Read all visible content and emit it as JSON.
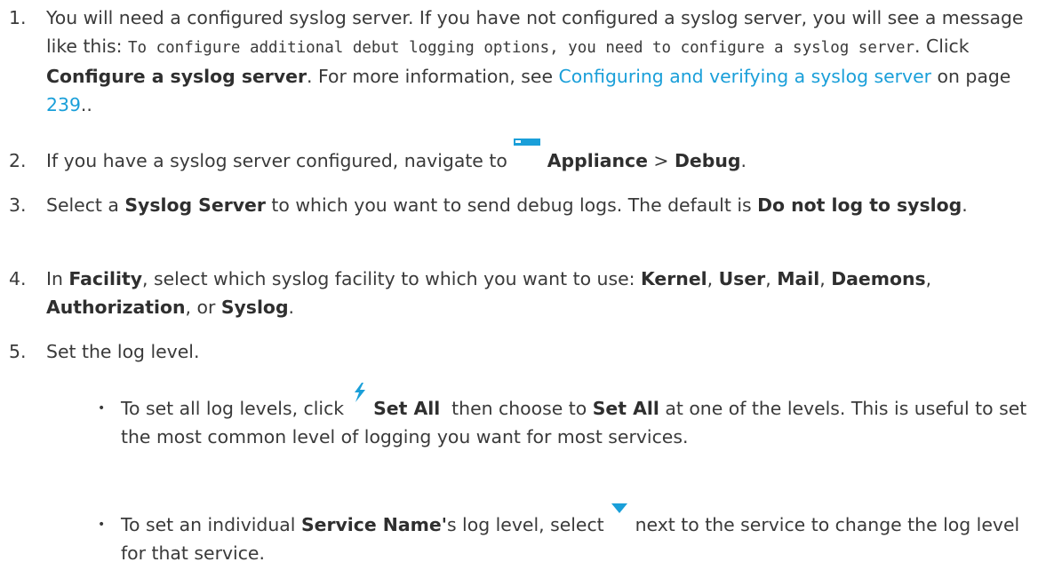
{
  "steps": [
    {
      "num": "1.",
      "t1": "You will need a configured syslog server. If you have not configured a syslog server, you will see a message like this: ",
      "code": "To configure additional debut logging options, you need to configure a syslog server",
      "t2": ". Click ",
      "b1": "Configure a syslog server",
      "t3": ". For more information, see ",
      "link": "Configuring and verifying a syslog server",
      "t4": " on page ",
      "page": "239",
      "t5": ".."
    },
    {
      "num": "2.",
      "t1": "If you have a syslog server configured, navigate to ",
      "b1": "Appliance",
      "t2": " > ",
      "b2": "Debug",
      "t3": "."
    },
    {
      "num": "3.",
      "t1": "Select a ",
      "b1": "Syslog Server",
      "t2": " to which you want to send debug logs. The default is ",
      "b2": "Do not log to syslog",
      "t3": "."
    },
    {
      "num": "4.",
      "t1": "In ",
      "b1": "Facility",
      "t2": ", select which syslog facility to which you want to use: ",
      "b2": "Kernel",
      "s1": ", ",
      "b3": "User",
      "s2": ", ",
      "b4": "Mail",
      "s3": ", ",
      "b5": "Daemons",
      "s4": ", ",
      "b6": "Authorization",
      "s5": ", or ",
      "b7": "Syslog",
      "s6": "."
    },
    {
      "num": "5.",
      "t1": "Set the log level."
    }
  ],
  "bullets": [
    {
      "dot": "•",
      "t1": "To set all log levels, click ",
      "b1": "Set All",
      "t2": "  then choose to ",
      "b2": "Set All",
      "t3": " at one of the levels. This is useful to set the most common level of logging you want for most services."
    },
    {
      "dot": "•",
      "t1": "To set an individual ",
      "b1": "Service Name'",
      "t2": "s log level, select ",
      "t3": " next to the service to change the log level for that service."
    }
  ],
  "icons": {
    "appliance": "appliance-icon",
    "set_all": "lightning-bolt-icon",
    "dropdown": "triangle-down-icon"
  },
  "colors": {
    "text": "#3a3a3a",
    "link": "#1a9fd9",
    "icon_blue": "#1a9fd9"
  }
}
